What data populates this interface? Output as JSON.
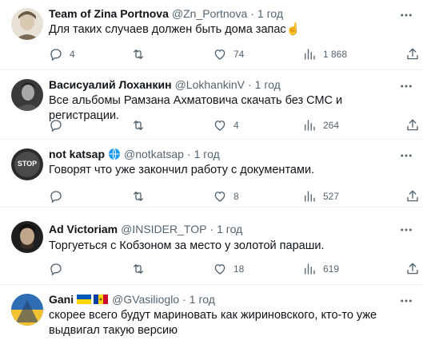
{
  "tweets": [
    {
      "name": "Team of Zina Portnova",
      "handle": "@Zn_Portnova",
      "time": "1 год",
      "text": "Для таких случаев должен быть дома запас☝️",
      "replies": "4",
      "retweets": "",
      "likes": "74",
      "views": "1 868"
    },
    {
      "name": "Васисуалий Лоханкин",
      "handle": "@LokhankinV",
      "time": "1 год",
      "text": "Все альбомы Рамзана Ахматовича скачать без СМС и регистрации.",
      "replies": "",
      "retweets": "",
      "likes": "4",
      "views": "264"
    },
    {
      "name": "not katsap",
      "handle": "@notkatsap",
      "time": "1 год",
      "text": "Говорят что уже закончил работу с документами.",
      "replies": "",
      "retweets": "",
      "likes": "8",
      "views": "527",
      "avatar_text": "STOP"
    },
    {
      "name": "Ad Victoriam",
      "handle": "@INSIDER_TOP",
      "time": "1 год",
      "text": "Торгуеться с Кобзоном за место у золотой параши.",
      "replies": "",
      "retweets": "",
      "likes": "18",
      "views": "619"
    },
    {
      "name": "Gani",
      "handle": "@GVasilioglo",
      "time": "1 год",
      "text": "скорее всего будут мариновать как жириновского, кто-то уже выдвигал такую версию"
    }
  ],
  "icons": {
    "reply": "reply-icon",
    "retweet": "retweet-icon",
    "like": "heart-icon",
    "views": "views-icon",
    "share": "share-icon",
    "more": "more-icon",
    "globe": "globe-icon"
  },
  "colors": {
    "text": "#0f1419",
    "secondary": "#536471",
    "divider": "#eff3f4",
    "verified_globe": "#1d9bf0"
  }
}
